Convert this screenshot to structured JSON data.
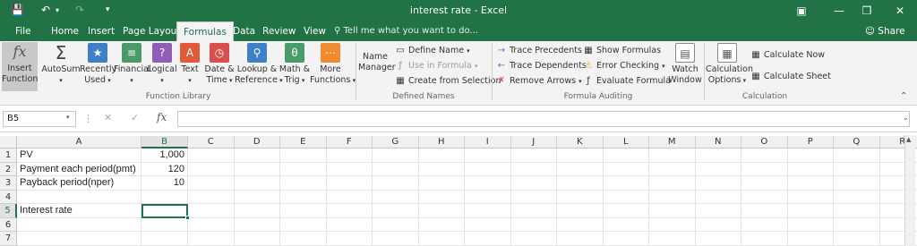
{
  "window": {
    "title": "interest rate - Excel"
  },
  "tabs": [
    "File",
    "Home",
    "Insert",
    "Page Layout",
    "Formulas",
    "Data",
    "Review",
    "View"
  ],
  "active_tab": "Formulas",
  "tell_me": "Tell me what you want to do...",
  "share": "Share",
  "ribbon": {
    "function_library": {
      "insert_function": [
        "Insert",
        "Function"
      ],
      "autosum": "AutoSum",
      "recently_used": [
        "Recently",
        "Used"
      ],
      "financial": "Financial",
      "logical": "Logical",
      "text": "Text",
      "date_time": [
        "Date &",
        "Time"
      ],
      "lookup_reference": [
        "Lookup &",
        "Reference"
      ],
      "math_trig": [
        "Math &",
        "Trig"
      ],
      "more_functions": [
        "More",
        "Functions"
      ],
      "label": "Function Library"
    },
    "defined_names": {
      "name_manager": [
        "Name",
        "Manager"
      ],
      "define_name": "Define Name",
      "use_in_formula": "Use in Formula",
      "create_from_selection": "Create from Selection",
      "label": "Defined Names"
    },
    "formula_auditing": {
      "trace_precedents": "Trace Precedents",
      "trace_dependents": "Trace Dependents",
      "remove_arrows": "Remove Arrows",
      "show_formulas": "Show Formulas",
      "error_checking": "Error Checking",
      "evaluate_formula": "Evaluate Formula",
      "watch_window": [
        "Watch",
        "Window"
      ],
      "label": "Formula Auditing"
    },
    "calculation": {
      "calculation_options": [
        "Calculation",
        "Options"
      ],
      "calculate_now": "Calculate Now",
      "calculate_sheet": "Calculate Sheet",
      "label": "Calculation"
    }
  },
  "formula_bar": {
    "name_box": "B5",
    "fx": "fx",
    "cancel": "✕",
    "enter": "✓",
    "content": ""
  },
  "columns": [
    "A",
    "B",
    "C",
    "D",
    "E",
    "F",
    "G",
    "H",
    "I",
    "J",
    "K",
    "L",
    "M",
    "N",
    "O",
    "P",
    "Q",
    "R"
  ],
  "rows": [
    {
      "num": "1",
      "a": "PV",
      "b": "1,000"
    },
    {
      "num": "2",
      "a": "Payment each period(pmt)",
      "b": "120"
    },
    {
      "num": "3",
      "a": "Payback period(nper)",
      "b": "10"
    },
    {
      "num": "4",
      "a": "",
      "b": ""
    },
    {
      "num": "5",
      "a": "Interest rate",
      "b": ""
    },
    {
      "num": "6",
      "a": "",
      "b": ""
    },
    {
      "num": "7",
      "a": "",
      "b": ""
    }
  ],
  "active_cell": "B5",
  "colors": {
    "accent": "#217346"
  }
}
